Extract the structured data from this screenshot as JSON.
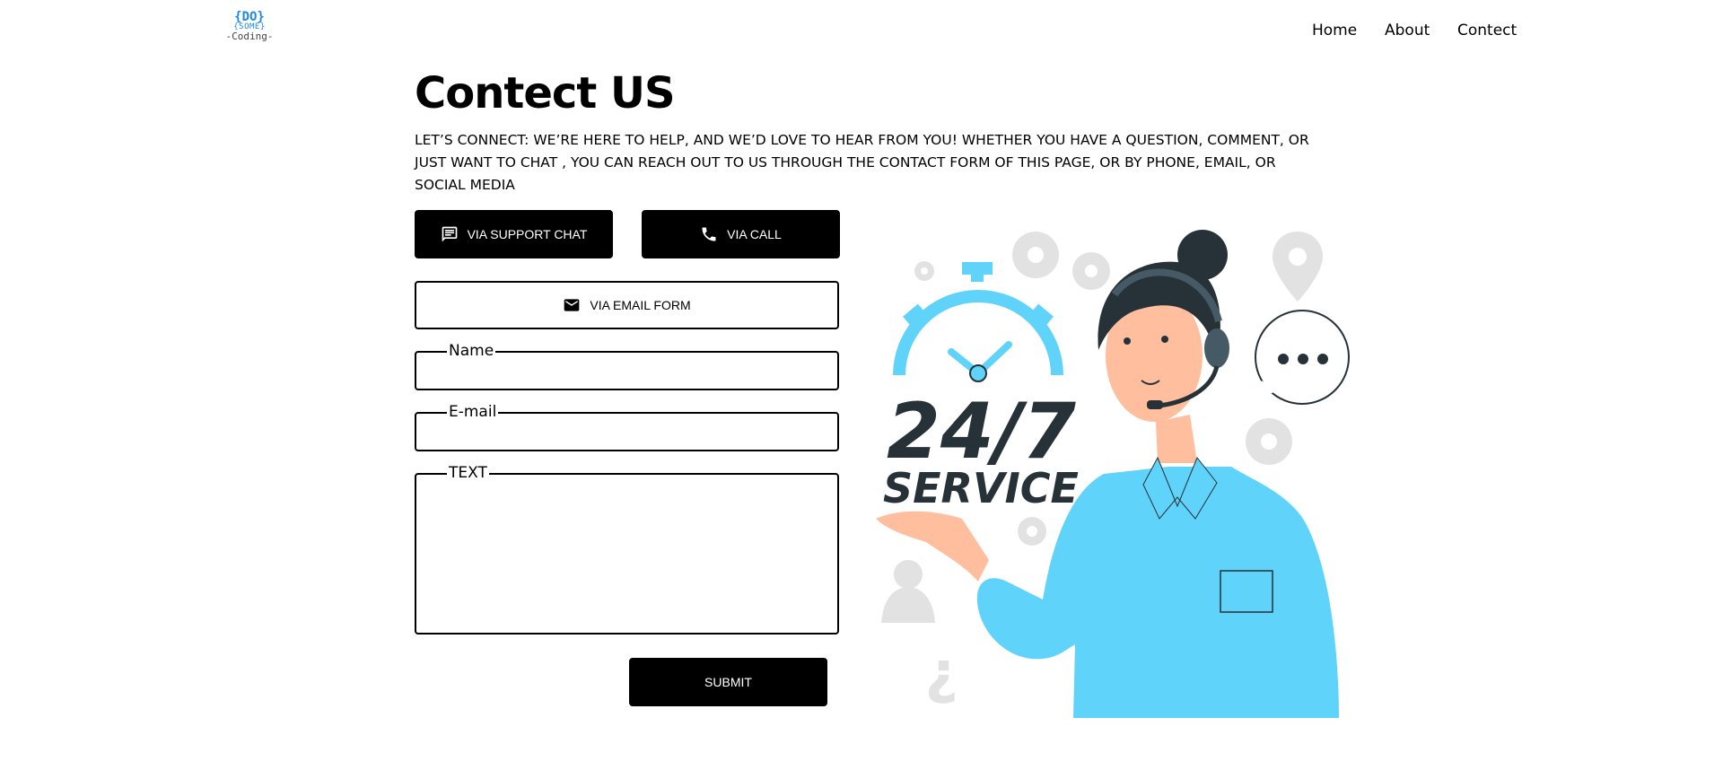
{
  "header": {
    "logo_text": [
      "{DO}",
      "{SOME}",
      "-Coding-"
    ],
    "nav": [
      "Home",
      "About",
      "Contect"
    ]
  },
  "page": {
    "title": "Contect US",
    "description": "LET’S CONNECT: WE’RE HERE TO HELP, AND WE’D LOVE TO HEAR FROM YOU! WHETHER YOU HAVE A QUESTION, COMMENT, OR JUST WANT TO CHAT , YOU CAN REACH OUT TO US THROUGH THE CONTACT FORM OF THIS PAGE, OR BY PHONE, EMAIL, OR SOCIAL MEDIA"
  },
  "contact_options": {
    "chat": {
      "label": "VIA SUPPORT CHAT",
      "icon": "chat-icon"
    },
    "call": {
      "label": "VIA CALL",
      "icon": "phone-icon"
    },
    "email": {
      "label": "VIA EMAIL FORM",
      "icon": "mail-icon"
    }
  },
  "form": {
    "name_label": "Name",
    "name_value": "",
    "email_label": "E-mail",
    "email_value": "",
    "text_label": "TEXT",
    "text_value": "",
    "submit_label": "SUBMIT"
  },
  "illustration": {
    "big_text": "24/7",
    "service_text": "SERVICE",
    "accent": "#5fd3f9",
    "dark": "#263238",
    "skin": "#ffbe9d"
  }
}
